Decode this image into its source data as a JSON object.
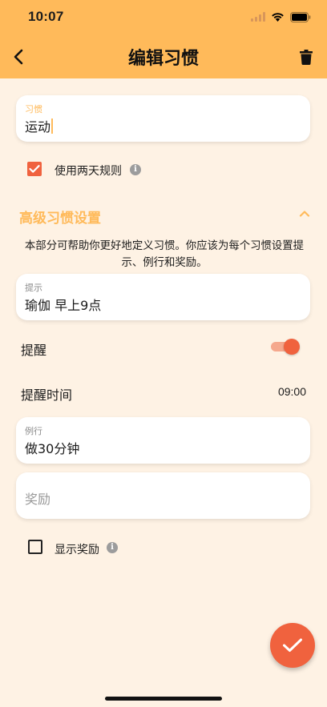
{
  "theme": {
    "accent": "#ffba5a",
    "primary": "#f0623e",
    "background": "#fef2e4"
  },
  "status_bar": {
    "time": "10:07",
    "icons": [
      "signal-icon",
      "wifi-icon",
      "battery-icon"
    ]
  },
  "header": {
    "title": "编辑习惯",
    "back_icon": "chevron-left-icon",
    "delete_icon": "trash-icon"
  },
  "habit": {
    "label": "习惯",
    "value": "运动"
  },
  "two_day_rule": {
    "label": "使用两天规则",
    "checked": true
  },
  "advanced": {
    "title": "高级习惯设置",
    "expanded": true,
    "description": "本部分可帮助你更好地定义习惯。你应该为每个习惯设置提示、例行和奖励。"
  },
  "cue": {
    "label": "提示",
    "value": "瑜伽 早上9点"
  },
  "reminder": {
    "label": "提醒",
    "enabled": true
  },
  "reminder_time": {
    "label": "提醒时间",
    "value": "09:00"
  },
  "routine": {
    "label": "例行",
    "value": "做30分钟"
  },
  "reward": {
    "placeholder": "奖励"
  },
  "show_reward": {
    "label": "显示奖励",
    "checked": false
  },
  "fab": {
    "icon": "check-icon"
  }
}
